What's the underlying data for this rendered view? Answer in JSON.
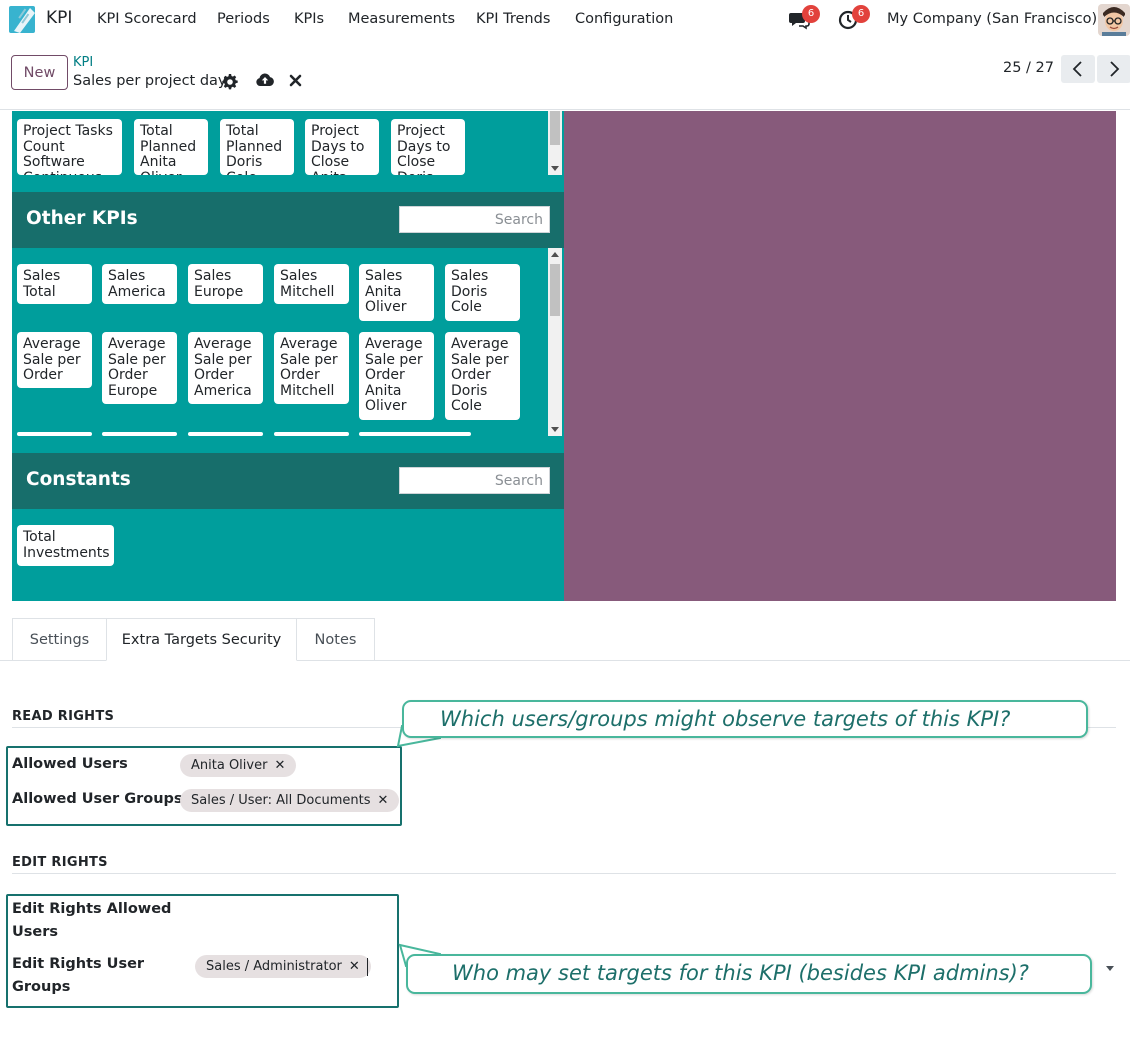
{
  "navbar": {
    "app_name": "KPI",
    "menu": [
      "KPI Scorecard",
      "Periods",
      "KPIs",
      "Measurements",
      "KPI Trends",
      "Configuration"
    ],
    "messages_count": "6",
    "activities_count": "6",
    "company": "My Company (San Francisco)"
  },
  "control_panel": {
    "new_label": "New",
    "breadcrumb": "KPI",
    "record_title": "Sales per project day",
    "pager": "25 / 27"
  },
  "formula": {
    "top_chips": [
      "Project Tasks Count Software Continuous",
      "Total Planned Anita Oliver",
      "Total Planned Doris Cole",
      "Project Days to Close Anita",
      "Project Days to Close Doris"
    ],
    "other_kpis": {
      "title": "Other KPIs",
      "search_placeholder": "Search",
      "chips": [
        "Sales Total",
        "Sales America",
        "Sales Europe",
        "Sales Mitchell",
        "Sales Anita Oliver",
        "Sales Doris Cole",
        "Average Sale per Order",
        "Average Sale per Order Europe",
        "Average Sale per Order America",
        "Average Sale per Order Mitchell",
        "Average Sale per Order Anita Oliver",
        "Average Sale per Order Doris Cole"
      ]
    },
    "constants": {
      "title": "Constants",
      "search_placeholder": "Search",
      "chips": [
        "Total Investments"
      ]
    }
  },
  "tabs": [
    "Settings",
    "Extra Targets Security",
    "Notes"
  ],
  "read_rights": {
    "title": "READ RIGHTS",
    "allowed_users_label": "Allowed Users",
    "allowed_users": [
      "Anita Oliver"
    ],
    "allowed_groups_label": "Allowed User Groups",
    "allowed_groups": [
      "Sales / User: All Documents"
    ],
    "callout": "Which users/groups might observe targets of this KPI?"
  },
  "edit_rights": {
    "title": "EDIT RIGHTS",
    "allowed_users_label": "Edit Rights Allowed Users",
    "groups_label": "Edit Rights User Groups",
    "groups": [
      "Sales / Administrator"
    ],
    "callout": "Who may set targets for this KPI (besides KPI admins)?"
  },
  "colors": {
    "panel_teal": "#009e9c",
    "section_header": "#176e6b",
    "panel_purple": "#875a7b",
    "brand": "#714b67",
    "callout_border": "#49b79c"
  }
}
